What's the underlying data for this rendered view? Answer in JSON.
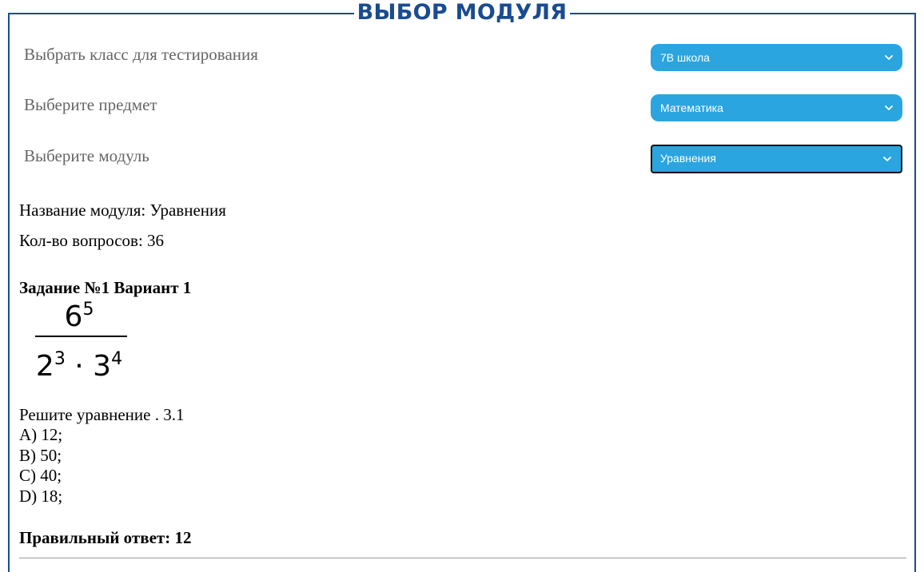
{
  "header": {
    "title": "ВЫБОР МОДУЛЯ"
  },
  "form": {
    "class_label": "Выбрать класс для тестирования",
    "class_value": "7В школа",
    "subject_label": "Выберите предмет",
    "subject_value": "Математика",
    "module_label": "Выберите модуль",
    "module_value": "Уравнения"
  },
  "module_info": {
    "name_line": "Название модуля: Уравнения",
    "count_line": "Кол-во вопросов: 36"
  },
  "task": {
    "heading": "Задание №1 Вариант 1",
    "formula": {
      "num_base": "6",
      "num_exp": "5",
      "den_base1": "2",
      "den_exp1": "3",
      "op": "·",
      "den_base2": "3",
      "den_exp2": "4"
    },
    "question": "Решите уравнение . 3.1",
    "options": [
      "A) 12;",
      "B) 50;",
      "C) 40;",
      "D) 18;"
    ],
    "answer": "Правильный ответ: 12"
  },
  "colors": {
    "accent": "#1b4b8f",
    "select_bg": "#2ba5df",
    "label_gray": "#666666"
  },
  "icons": {
    "dropdown": "chevron-down-icon"
  }
}
